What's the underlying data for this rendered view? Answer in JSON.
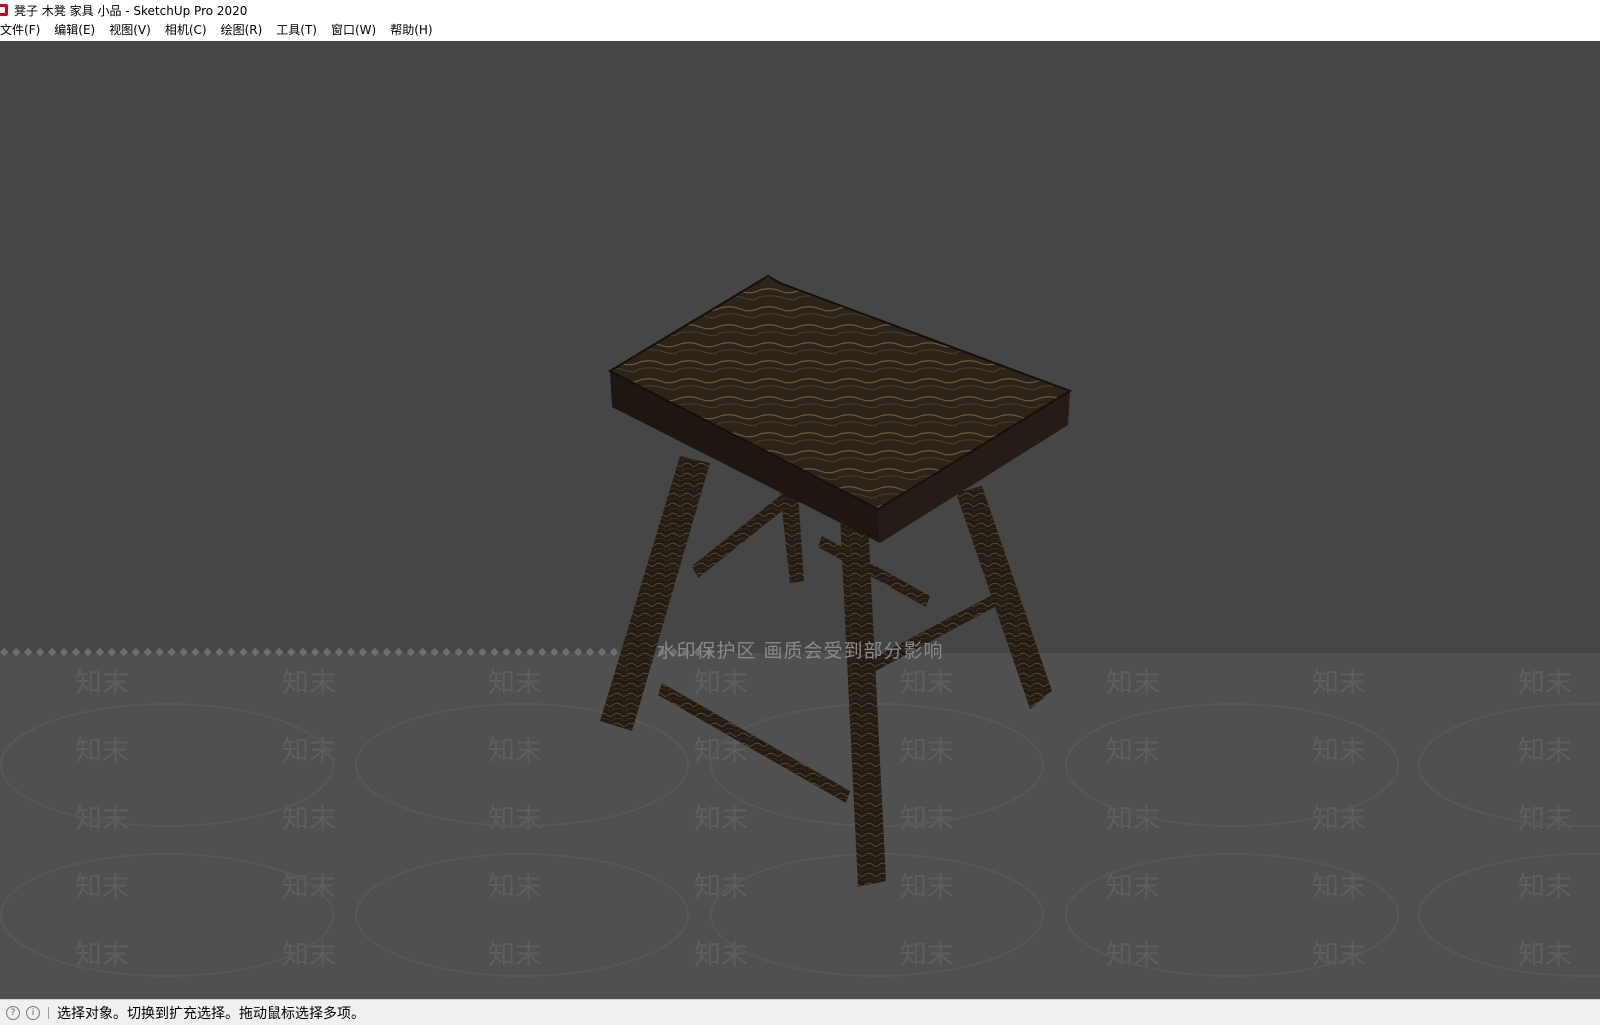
{
  "window": {
    "title": "凳子 木凳 家具 小品 - SketchUp Pro 2020"
  },
  "menu": [
    "文件(F)",
    "编辑(E)",
    "视图(V)",
    "相机(C)",
    "绘图(R)",
    "工具(T)",
    "窗口(W)",
    "帮助(H)"
  ],
  "watermark": {
    "banner": "水印保护区   画质会受到部分影响",
    "brand": "知末"
  },
  "status": {
    "text": "选择对象。切换到扩充选择。拖动鼠标选择多项。"
  },
  "colors": {
    "viewport_bg": "#464646",
    "stool_wood": "#2a2118",
    "wood_grain": "#6b5a3f"
  }
}
